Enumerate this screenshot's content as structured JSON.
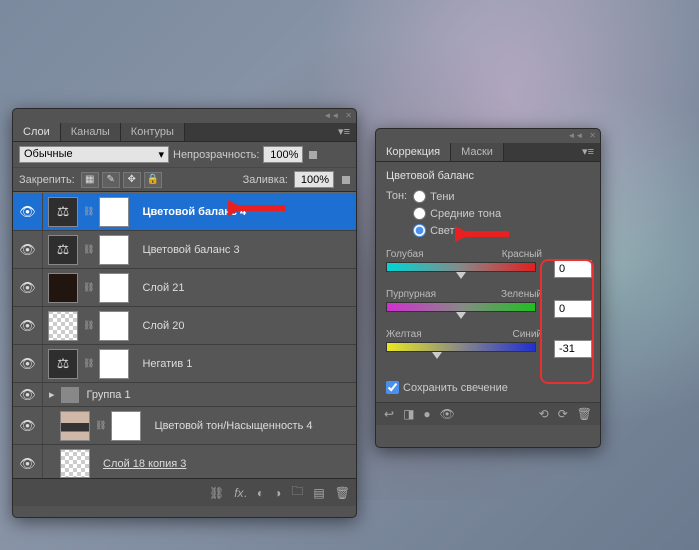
{
  "layers_panel": {
    "tabs": [
      "Слои",
      "Каналы",
      "Контуры"
    ],
    "blend_mode": "Обычные",
    "opacity_label": "Непрозрачность:",
    "opacity_value": "100%",
    "fill_label": "Заливка:",
    "fill_value": "100%",
    "lock_label": "Закрепить:",
    "layers": [
      {
        "name": "Цветовой баланс 4",
        "thumbs": [
          "adj",
          "mask"
        ],
        "selected": true
      },
      {
        "name": "Цветовой баланс 3",
        "thumbs": [
          "adj",
          "mask"
        ]
      },
      {
        "name": "Слой 21",
        "thumbs": [
          "dark",
          "mask"
        ]
      },
      {
        "name": "Слой 20",
        "thumbs": [
          "trans",
          "mask"
        ]
      },
      {
        "name": "Негатив 1",
        "thumbs": [
          "adj",
          "mask"
        ]
      },
      {
        "name": "Группа 1",
        "group": true
      },
      {
        "name": "Цветовой тон/Насыщенность 4",
        "thumbs": [
          "half",
          "mask"
        ],
        "indent": true
      },
      {
        "name": "Слой 18 копия 3",
        "thumbs": [
          "trans"
        ],
        "indent": true,
        "underline": true
      },
      {
        "name": "",
        "thumbs": [
          ""
        ],
        "indent": true,
        "cut": true
      }
    ]
  },
  "adjustments_panel": {
    "tabs": [
      "Коррекция",
      "Маски"
    ],
    "title": "Цветовой баланс",
    "tone_label": "Тон:",
    "tone_options": [
      {
        "label": "Тени",
        "checked": false
      },
      {
        "label": "Средние тона",
        "checked": false
      },
      {
        "label": "Света",
        "checked": true
      }
    ],
    "sliders": [
      {
        "left": "Голубая",
        "right": "Красный",
        "value": "0",
        "pos": 50,
        "cls": "cyan-red"
      },
      {
        "left": "Пурпурная",
        "right": "Зеленый",
        "value": "0",
        "pos": 50,
        "cls": "mag-grn"
      },
      {
        "left": "Желтая",
        "right": "Синий",
        "value": "-31",
        "pos": 34,
        "cls": "yel-blu"
      }
    ],
    "preserve_lum": "Сохранить свечение"
  }
}
